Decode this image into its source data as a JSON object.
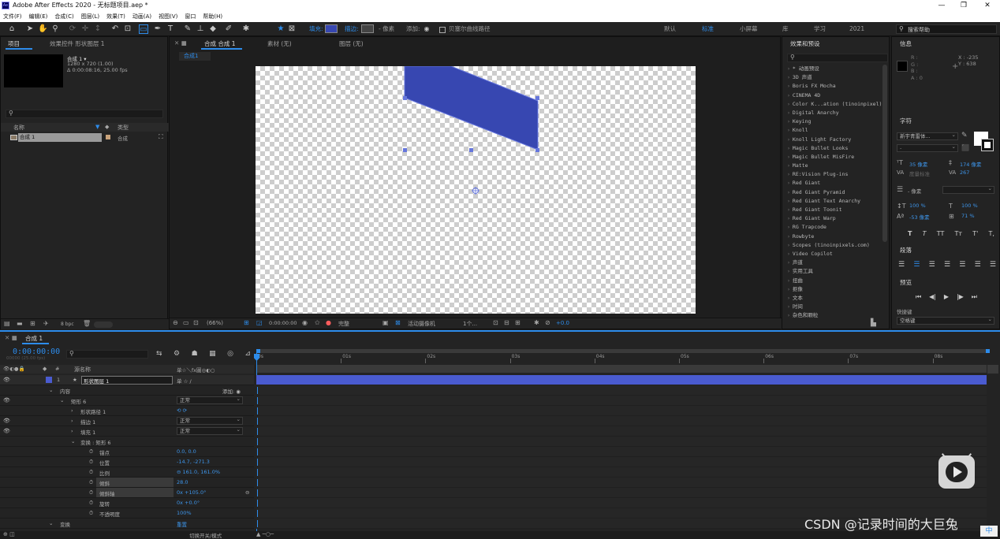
{
  "window": {
    "logo": "Ae",
    "title": "Adobe After Effects 2020 - 无标题项目.aep *",
    "min": "—",
    "max": "❐",
    "close": "✕"
  },
  "menu": [
    "文件(F)",
    "编辑(E)",
    "合成(C)",
    "图层(L)",
    "效果(T)",
    "动画(A)",
    "视图(V)",
    "窗口",
    "帮助(H)"
  ],
  "toolbar": {
    "fill_label": "填充:",
    "stroke_label": "描边:",
    "px": "- 像素",
    "add_label": "添加:",
    "bezier_label": "贝塞尔曲线路径",
    "workspaces": [
      "默认",
      "标准",
      "小屏幕",
      "库",
      "学习",
      "2021"
    ],
    "search_help": "搜索帮助"
  },
  "project_panel": {
    "tab_project": "项目",
    "tab_effects": "效果控件 形状图层 1",
    "comp_name": "合成 1 ▾",
    "comp_size": "1280 x 720 (1.00)",
    "comp_duration": "Δ 0:00:08:16, 25.00 fps",
    "col_name": "名称",
    "col_type": "类型",
    "items": [
      {
        "name": "合成 1",
        "type": "合成"
      }
    ],
    "bpc": "8 bpc"
  },
  "comp_panel": {
    "tab": "合成 合成 1",
    "tab_material": "素材 (无)",
    "tab_layer": "图层 (无)",
    "subtab": "合成1",
    "zoom": "(66%)",
    "time": "0:00:00:00",
    "quality": "完整",
    "camera": "活动摄像机",
    "views": "1个...",
    "exposure": "+0.0"
  },
  "effects_panel": {
    "title": "效果和预设",
    "items": [
      "* 动画预设",
      "3D 声道",
      "Boris FX Mocha",
      "CINEMA 4D",
      "Color K...ation (tinoinpixel)",
      "Digital Anarchy",
      "Keying",
      "Knoll",
      "Knoll Light Factory",
      "Magic Bullet Looks",
      "Magic Bullet MisFire",
      "Matte",
      "RE:Vision Plug-ins",
      "Red Giant",
      "Red Giant Pyramid",
      "Red Giant Text Anarchy",
      "Red Giant Toonit",
      "Red Giant Warp",
      "RG Trapcode",
      "Rowbyte",
      "Scopes (tinoinpixels.com)",
      "Video Copilot",
      "声道",
      "实用工具",
      "扭曲",
      "抠像",
      "文本",
      "时间",
      "杂色和颗粒"
    ]
  },
  "info_panel": {
    "title": "信息",
    "rgb": [
      "R :",
      "G :",
      "B :",
      "A : 0"
    ],
    "x": "X : -235",
    "y": "Y : 638"
  },
  "char_panel": {
    "title": "字符",
    "font": "新宇青雷体...",
    "size": "35 像素",
    "leading": "174 像素",
    "kerning": "度量标准",
    "tracking": "267",
    "stroke": "- 像素",
    "vscale": "100 %",
    "hscale": "100 %",
    "baseline": "-53 像素",
    "tsume": "71 %",
    "styles": [
      "T",
      "T",
      "TT",
      "Tт",
      "T'",
      "T,"
    ]
  },
  "para_panel": {
    "title": "段落"
  },
  "preview_panel": {
    "title": "预览",
    "shortcut_label": "快捷键",
    "shortcut": "空格键"
  },
  "timeline": {
    "tab": "合成 1",
    "timecode": "0:00:00:00",
    "timecode_sub": "00000 (25.00 fps)",
    "col_num": "#",
    "col_source": "源名称",
    "col_switches": "单☆＼fx圖◎◐○",
    "ruler": [
      "0s",
      "01s",
      "02s",
      "03s",
      "04s",
      "05s",
      "06s",
      "07s",
      "08s"
    ],
    "toggle_label": "切换开关/模式",
    "rows": [
      {
        "name": "形状图层 1",
        "indent": 0,
        "value": "",
        "eye": true,
        "num": "1"
      },
      {
        "name": "内容",
        "indent": 1,
        "value": "添加: ◉",
        "eye": false
      },
      {
        "name": "矩形 6",
        "indent": 2,
        "value": "正常",
        "eye": true,
        "dd": true
      },
      {
        "name": "形状路径 1",
        "indent": 3,
        "value": "⟲ ⟳",
        "eye": false
      },
      {
        "name": "描边 1",
        "indent": 3,
        "value": "正常",
        "eye": true,
        "dd": true
      },
      {
        "name": "填充 1",
        "indent": 3,
        "value": "正常",
        "eye": true,
        "dd": true
      },
      {
        "name": "变换 : 矩形 6",
        "indent": 3,
        "value": "",
        "eye": false
      },
      {
        "name": "锚点",
        "indent": 4,
        "value": "0.0, 0.0",
        "eye": false,
        "sw": true
      },
      {
        "name": "位置",
        "indent": 4,
        "value": "-14.7, -271.3",
        "eye": false,
        "sw": true
      },
      {
        "name": "比例",
        "indent": 4,
        "value": "⊖ 161.0, 161.0%",
        "eye": false,
        "sw": true
      },
      {
        "name": "倾斜",
        "indent": 4,
        "value": "28.0",
        "eye": false,
        "sw": true,
        "hl": true
      },
      {
        "name": "倾斜轴",
        "indent": 4,
        "value": "0x +105.0°",
        "eye": false,
        "sw": true,
        "hl": true
      },
      {
        "name": "旋转",
        "indent": 4,
        "value": "0x +0.0°",
        "eye": false,
        "sw": true
      },
      {
        "name": "不透明度",
        "indent": 4,
        "value": "100%",
        "eye": false,
        "sw": true
      },
      {
        "name": "变换",
        "indent": 1,
        "value": "重置",
        "eye": false
      }
    ]
  },
  "watermark": "CSDN @记录时间的大巨兔",
  "ime": "中",
  "colors": {
    "accent": "#2d8ceb",
    "shape": "#3747b1",
    "layer_bar": "#4a5bd0"
  }
}
